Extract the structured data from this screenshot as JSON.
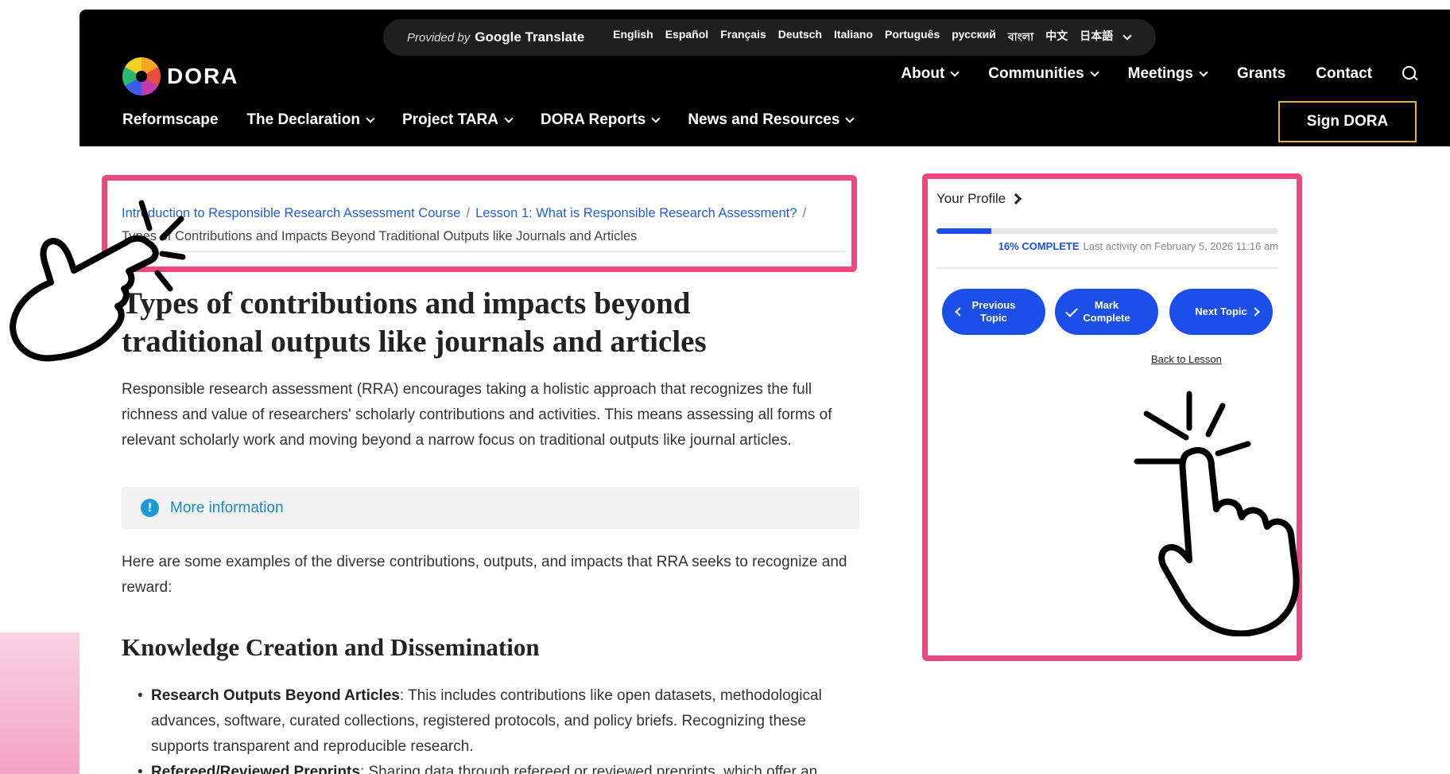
{
  "translate": {
    "provided_by": "Provided by",
    "service": "Google Translate",
    "languages": [
      "English",
      "Español",
      "Français",
      "Deutsch",
      "Italiano",
      "Português",
      "русский",
      "বাংলা",
      "中文",
      "日本語"
    ]
  },
  "brand": {
    "name": "DORA"
  },
  "top_nav": {
    "about": "About",
    "communities": "Communities",
    "meetings": "Meetings",
    "grants": "Grants",
    "contact": "Contact"
  },
  "main_nav": {
    "reformscape": "Reformscape",
    "declaration": "The Declaration",
    "tara": "Project TARA",
    "reports": "DORA Reports",
    "news": "News and Resources",
    "sign": "Sign DORA"
  },
  "breadcrumb": {
    "course": "Introduction to Responsible Research Assessment Course",
    "lesson": "Lesson 1: What is Responsible Research Assessment?",
    "current": "Types of Contributions and Impacts Beyond Traditional Outputs like Journals and Articles",
    "separator": "/"
  },
  "article": {
    "title": "Types of contributions and impacts beyond traditional outputs like journals and articles",
    "intro": "Responsible research assessment (RRA) encourages taking a holistic approach that recognizes the full richness and value of researchers' scholarly contributions and activities. This means assessing all forms of relevant scholarly work and moving beyond a narrow focus on traditional outputs like journal articles.",
    "more_info": "More information",
    "info_icon_glyph": "!",
    "examples": "Here are some examples of the diverse contributions, outputs, and impacts that RRA seeks to recognize and reward:",
    "section_heading": "Knowledge Creation and Dissemination",
    "bullets": [
      {
        "bold": "Research Outputs Beyond Articles",
        "text": ": This includes contributions like open datasets, methodological advances, software, curated collections, registered protocols, and policy briefs. Recognizing these supports transparent and reproducible research."
      },
      {
        "bold": "Refereed/Reviewed Preprints",
        "text": ": Sharing data through refereed or reviewed preprints, which offer an"
      }
    ]
  },
  "profile": {
    "title": "Your Profile",
    "progress_percent": 16,
    "progress_label": "16% COMPLETE",
    "last_activity": "Last activity on February 5, 2026 11:16 am",
    "prev_button": "Previous Topic",
    "mark_button": "Mark Complete",
    "next_button": "Next Topic",
    "back_link": "Back to Lesson"
  },
  "colors": {
    "highlight": "#e84a7f",
    "accent_blue": "#1c50e6",
    "link_blue": "#1f5fd6",
    "sign_border": "#e5b23a"
  }
}
